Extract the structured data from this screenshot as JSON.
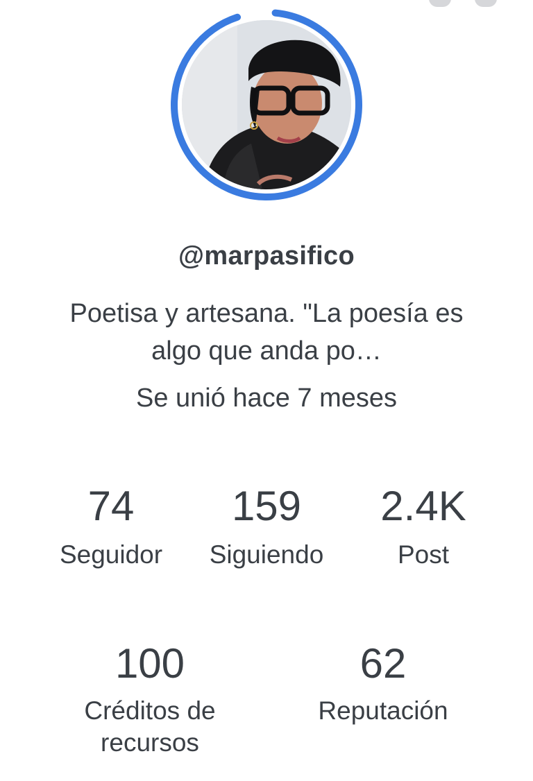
{
  "profile": {
    "username": "@marpasifico",
    "bio": "Poetisa y artesana. \"La poesía es algo que anda po…",
    "joined": "Se unió hace 7 meses",
    "avatar_ring_color": "#3a7be0"
  },
  "stats": {
    "followers": {
      "value": "74",
      "label": "Seguidor"
    },
    "following": {
      "value": "159",
      "label": "Siguiendo"
    },
    "posts": {
      "value": "2.4K",
      "label": "Post"
    },
    "credits": {
      "value": "100",
      "label": "Créditos de recursos"
    },
    "reputation": {
      "value": "62",
      "label": "Reputación"
    }
  }
}
